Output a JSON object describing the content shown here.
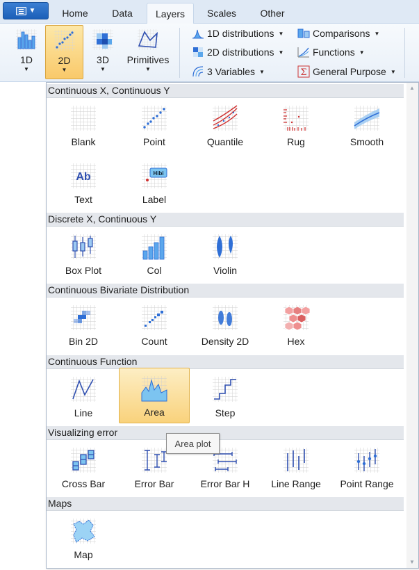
{
  "tabs": [
    "Home",
    "Data",
    "Layers",
    "Scales",
    "Other"
  ],
  "active_tab": "Layers",
  "ribbon": {
    "big_buttons": [
      "1D",
      "2D",
      "3D",
      "Primitives"
    ],
    "pressed_button": "2D",
    "col1": [
      "1D distributions",
      "2D distributions",
      "3 Variables"
    ],
    "col2": [
      "Comparisons",
      "Functions",
      "General Purpose"
    ]
  },
  "sections": [
    {
      "title": "Continuous X, Continuous Y",
      "items": [
        "Blank",
        "Point",
        "Quantile",
        "Rug",
        "Smooth",
        "Text",
        "Label"
      ]
    },
    {
      "title": "Discrete X, Continuous Y",
      "items": [
        "Box Plot",
        "Col",
        "Violin"
      ]
    },
    {
      "title": "Continuous Bivariate Distribution",
      "items": [
        "Bin 2D",
        "Count",
        "Density 2D",
        "Hex"
      ]
    },
    {
      "title": "Continuous Function",
      "items": [
        "Line",
        "Area",
        "Step"
      ]
    },
    {
      "title": "Visualizing error",
      "items": [
        "Cross Bar",
        "Error Bar",
        "Error Bar H",
        "Line Range",
        "Point Range"
      ]
    },
    {
      "title": "Maps",
      "items": [
        "Map"
      ]
    }
  ],
  "icon_text": {
    "text": "Ab",
    "label": "Hibi"
  },
  "hovered_item": "Area",
  "tooltip": "Area plot",
  "colors": {
    "accent_blue": "#2f6fd6",
    "hover_gold": "#f9d27c",
    "section_bg": "#e4e7ec"
  }
}
